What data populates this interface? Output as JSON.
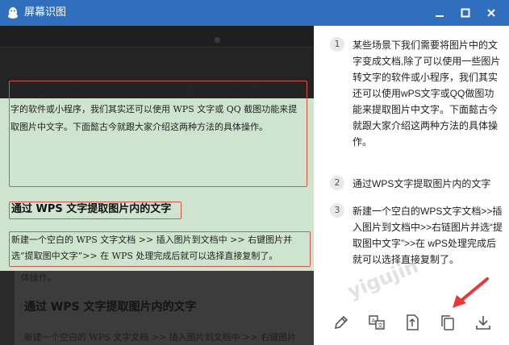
{
  "window": {
    "title": "屏幕识图",
    "controls": {
      "minimize": "minimize",
      "maximize": "maximize",
      "close": "close"
    }
  },
  "image": {
    "para1": "某些场景下我们需要将图片中的文字变成文档，除了可以使用一些图片转文字的软件或小程序，我们其实还可以使用 WPS 文字或 QQ 截图功能来提取图片中文字。下面懿古今就跟大家介绍这两种方法的具体操作。",
    "heading": "通过 WPS 文字提取图片内的文字",
    "para2": "新建一个空白的 WPS 文字文档 >> 插入图片到文档中 >> 右键图片并选“提取图中文字”>> 在 WPS 处理完成后就可以选择直接复制了。",
    "lower_line0": "体操作。",
    "lower_heading": "通过 WPS 文字提取图片内的文字",
    "lower_line1": "新建一个空白的 WPS 文字文档 >> 插入图片到文档中 >> 右键图片"
  },
  "results": [
    {
      "num": "1",
      "text": "某些场景下我们需要将图片中的文字变成文档,除了可以使用一些图片转文字的软件或小程序，我们其实还可以使用wPS文字或QQ做图功能来提取图片中文字。下面懿古今就跟大家介绍这两种方法的具体操作。"
    },
    {
      "num": "2",
      "text": "通过WPS文字提取图片内的文字"
    },
    {
      "num": "3",
      "text": "新建一个空白的WPS文字文档>>插入图片到文档中>>右链图片并选“提取图中文字”>>在 wPS处理完成后就可以选择直接复制了。"
    }
  ],
  "toolbar": [
    {
      "name": "edit-icon"
    },
    {
      "name": "translate-icon"
    },
    {
      "name": "export-icon"
    },
    {
      "name": "copy-icon"
    },
    {
      "name": "download-icon"
    }
  ],
  "watermark": "yigujin",
  "colors": {
    "titlebar": "#2f6fbd",
    "highlight": "#cfe4cf",
    "box": "#d9534f",
    "arrow": "#e53935"
  }
}
